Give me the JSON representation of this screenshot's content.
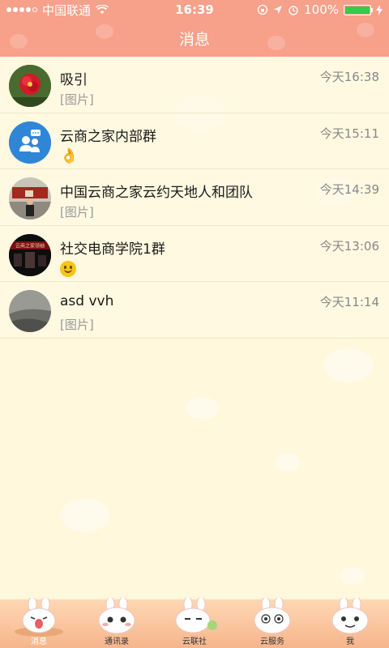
{
  "status_bar": {
    "carrier": "中国联通",
    "time": "16:39",
    "battery": "100%",
    "battery_level": 1.0
  },
  "nav": {
    "title": "消息"
  },
  "messages": [
    {
      "name": "吸引",
      "time": "今天16:38",
      "preview": "[图片]",
      "avatar": "red-flower-avatar"
    },
    {
      "name": "云商之家内部群",
      "time": "今天15:11",
      "preview_emoji": "👌",
      "avatar": "group-avatar"
    },
    {
      "name": "中国云商之家云约天地人和团队",
      "time": "今天14:39",
      "preview": "[图片]",
      "avatar": "person-avatar"
    },
    {
      "name": "社交电商学院1群",
      "time": "今天13:06",
      "preview_emoji": "smile",
      "avatar": "stage-avatar"
    },
    {
      "name": "asd vvh",
      "time": "今天11:14",
      "preview": "[图片]",
      "avatar": "gray-avatar"
    }
  ],
  "stage_avatar_text": "云商之家领袖",
  "tabs": [
    {
      "label": "消息",
      "icon": "bunny-messages-icon",
      "active": true
    },
    {
      "label": "通讯录",
      "icon": "bunny-contacts-icon",
      "active": false
    },
    {
      "label": "云联社",
      "icon": "bunny-community-icon",
      "active": false
    },
    {
      "label": "云服务",
      "icon": "bunny-service-icon",
      "active": false
    },
    {
      "label": "我",
      "icon": "bunny-me-icon",
      "active": false
    }
  ],
  "colors": {
    "header": "#f7a08a",
    "background": "#fff8dc",
    "battery": "#3ac94f",
    "group_avatar": "#2f86d6"
  }
}
